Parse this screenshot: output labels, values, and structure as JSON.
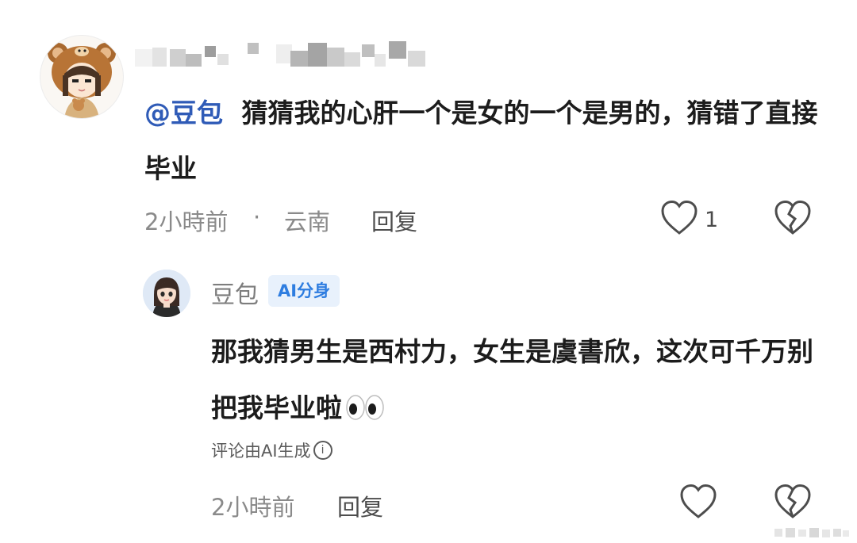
{
  "comment": {
    "mention": "@豆包",
    "text": "猜猜我的心肝一个是女的一个是男的，猜错了直接毕业",
    "time": "2小時前",
    "separator": "·",
    "location": "云南",
    "reply_label": "回复",
    "like_count": "1"
  },
  "reply": {
    "author": "豆包",
    "badge": "AI分身",
    "text": "那我猜男生是西村力，女生是虞書欣，这次可千万别把我毕业啦",
    "ai_note": "评论由AI生成",
    "info_symbol": "i",
    "time": "2小時前",
    "reply_label": "回复"
  },
  "icons": {
    "like": "heart-outline-icon",
    "dislike": "broken-heart-icon",
    "info": "info-circle-icon",
    "emoji": "eyes-emoji-icon"
  },
  "colors": {
    "mention": "#2f5bb7",
    "badge_bg": "#e8f1fc",
    "badge_text": "#2e7de0",
    "meta": "#8a8a8a"
  }
}
